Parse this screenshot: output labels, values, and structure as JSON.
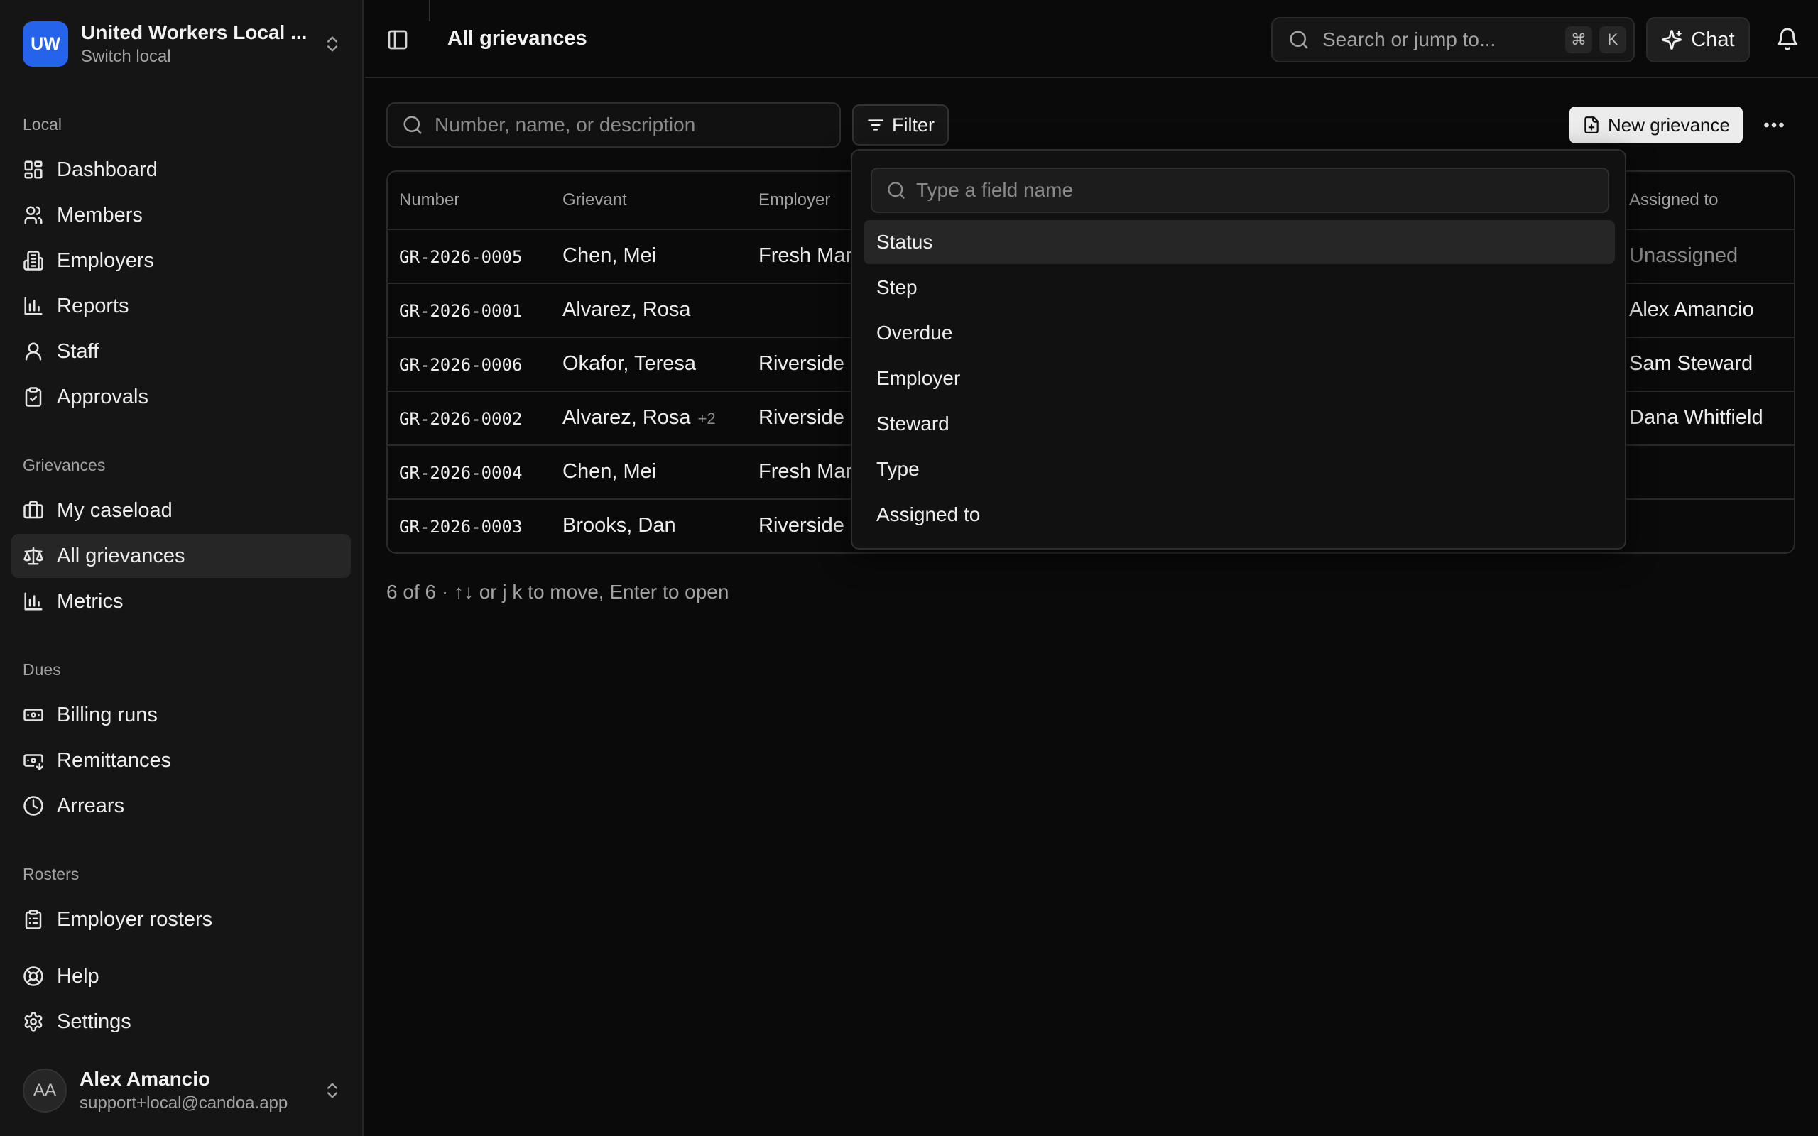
{
  "org": {
    "initials": "UW",
    "name": "United Workers Local ...",
    "subtitle": "Switch local"
  },
  "sidebar": {
    "local_label": "Local",
    "local_items": [
      {
        "label": "Dashboard",
        "icon": "dashboard-icon"
      },
      {
        "label": "Members",
        "icon": "members-icon"
      },
      {
        "label": "Employers",
        "icon": "building-icon"
      },
      {
        "label": "Reports",
        "icon": "bar-chart-icon"
      },
      {
        "label": "Staff",
        "icon": "user-icon"
      },
      {
        "label": "Approvals",
        "icon": "clipboard-check-icon"
      }
    ],
    "grievances_label": "Grievances",
    "grievance_items": [
      {
        "label": "My caseload",
        "icon": "briefcase-icon"
      },
      {
        "label": "All grievances",
        "icon": "scale-icon",
        "active": true
      },
      {
        "label": "Metrics",
        "icon": "bar-chart-icon"
      }
    ],
    "dues_label": "Dues",
    "dues_items": [
      {
        "label": "Billing runs",
        "icon": "banknote-icon"
      },
      {
        "label": "Remittances",
        "icon": "banknote-arrow-icon"
      },
      {
        "label": "Arrears",
        "icon": "clock-icon"
      }
    ],
    "rosters_label": "Rosters",
    "roster_items": [
      {
        "label": "Employer rosters",
        "icon": "clipboard-list-icon"
      }
    ],
    "help": "Help",
    "settings": "Settings"
  },
  "user": {
    "initials": "AA",
    "name": "Alex Amancio",
    "email": "support+local@candoa.app"
  },
  "topbar": {
    "title": "All grievances",
    "search_placeholder": "Search or jump to...",
    "shortcut_mod": "⌘",
    "shortcut_key": "K",
    "chat_label": "Chat"
  },
  "toolbar": {
    "search_placeholder": "Number, name, or description",
    "filter_label": "Filter",
    "new_label": "New grievance"
  },
  "table": {
    "columns": {
      "number": "Number",
      "grievant": "Grievant",
      "employer": "Employer",
      "assigned": "Assigned to"
    },
    "rows": [
      {
        "number": "GR-2026-0005",
        "grievant": "Chen, Mei",
        "extra": "",
        "employer": "Fresh Mar",
        "assigned": "Unassigned",
        "assigned_muted": true
      },
      {
        "number": "GR-2026-0001",
        "grievant": "Alvarez, Rosa",
        "extra": "",
        "employer": "",
        "assigned": "Alex Amancio"
      },
      {
        "number": "GR-2026-0006",
        "grievant": "Okafor, Teresa",
        "extra": "",
        "employer": "Riverside F",
        "assigned": "Sam Steward"
      },
      {
        "number": "GR-2026-0002",
        "grievant": "Alvarez, Rosa",
        "extra": "+2",
        "employer": "Riverside F",
        "assigned": "Dana Whitfield"
      },
      {
        "number": "GR-2026-0004",
        "grievant": "Chen, Mei",
        "extra": "",
        "employer": "Fresh Mar",
        "assigned": ""
      },
      {
        "number": "GR-2026-0003",
        "grievant": "Brooks, Dan",
        "extra": "",
        "employer": "Riverside F",
        "assigned": ""
      }
    ]
  },
  "footer": "6 of 6 · ↑↓ or j k to move, Enter to open",
  "filter_menu": {
    "search_placeholder": "Type a field name",
    "items": [
      "Status",
      "Step",
      "Overdue",
      "Employer",
      "Steward",
      "Type",
      "Assigned to"
    ],
    "highlighted_index": 0
  },
  "colors": {
    "accent": "#2563eb",
    "background": "#0a0a0a",
    "sidebar": "#151515"
  }
}
